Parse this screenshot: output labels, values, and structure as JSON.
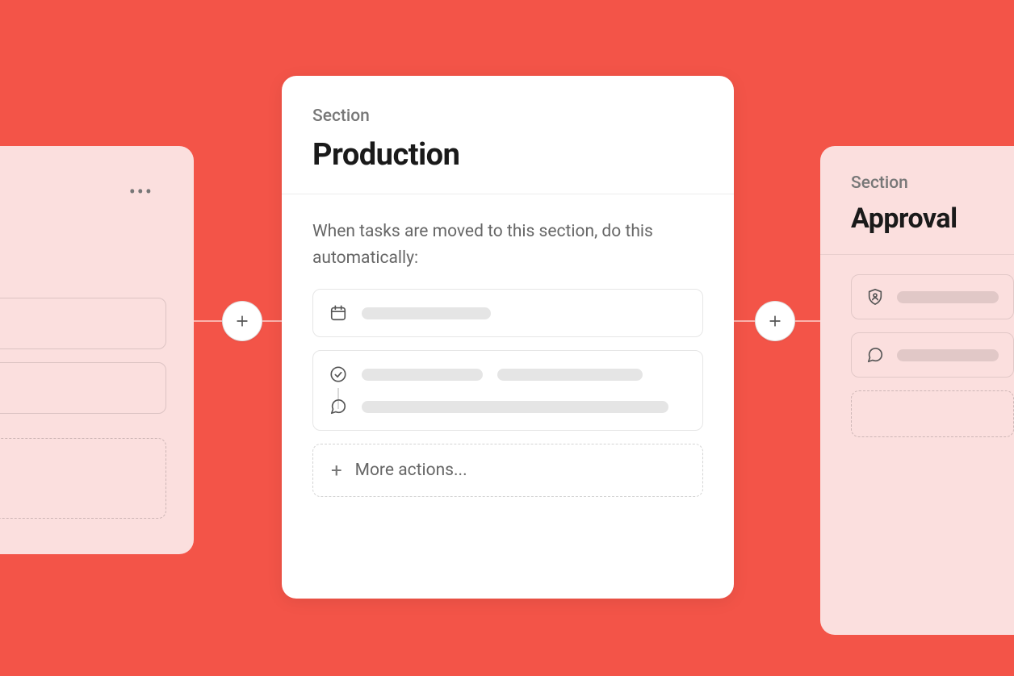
{
  "section_label": "Section",
  "center": {
    "title": "Production",
    "description": "When tasks are moved to this section, do this automatically:",
    "more_actions_label": "More actions..."
  },
  "right": {
    "title": "Approval"
  }
}
